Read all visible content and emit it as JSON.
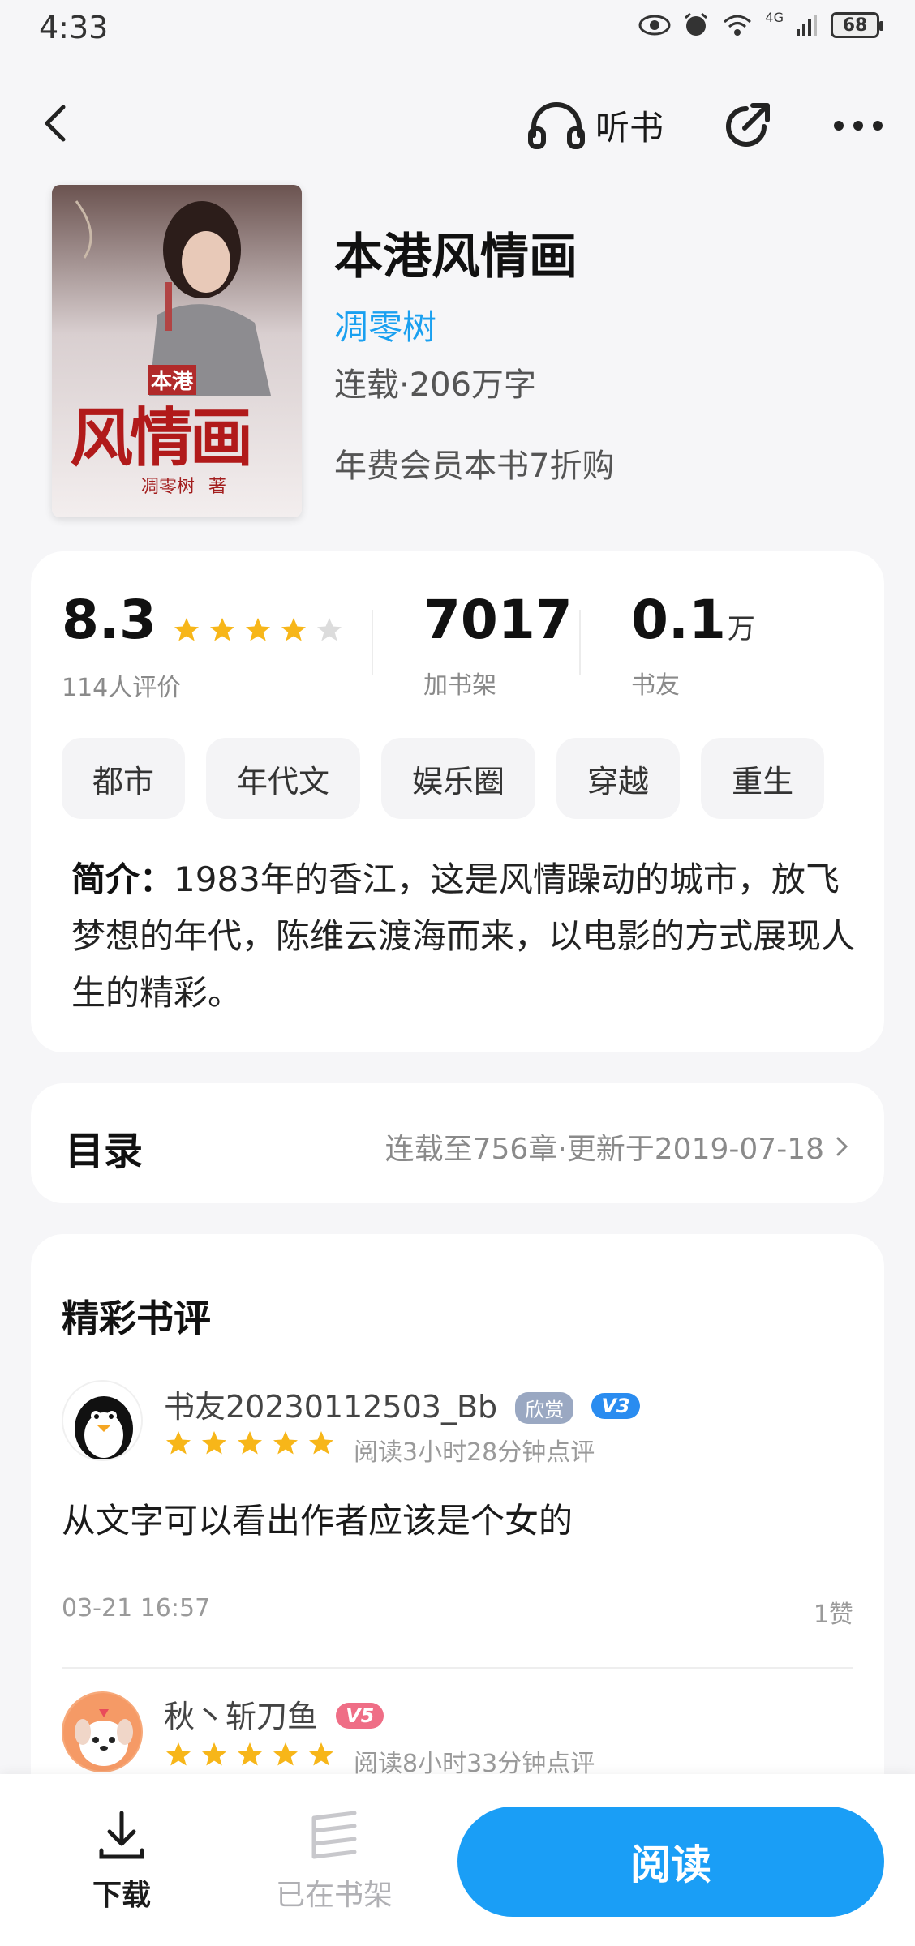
{
  "status_bar": {
    "time": "4:33",
    "network": "4G",
    "battery": "68"
  },
  "nav": {
    "listen_label": "听书"
  },
  "book": {
    "cover_small_text": "本港",
    "cover_big_text": "风情画",
    "cover_author_text": "凋零树",
    "cover_suffix": "著",
    "title": "本港风情画",
    "author": "凋零树",
    "meta": "连载·206万字",
    "offer": "年费会员本书7折购"
  },
  "stats": {
    "rating": "8.3",
    "rating_stars": 4,
    "rating_label": "114人评价",
    "shelf_count": "7017",
    "shelf_label": "加书架",
    "friends_count": "0.1",
    "friends_unit": "万",
    "friends_label": "书友"
  },
  "tags": [
    "都市",
    "年代文",
    "娱乐圈",
    "穿越",
    "重生"
  ],
  "intro": {
    "label": "简介：",
    "text": "1983年的香江，这是风情躁动的城市，放飞梦想的年代，陈维云渡海而来，以电影的方式展现人生的精彩。"
  },
  "toc": {
    "title": "目录",
    "info": "连载至756章·更新于2019-07-18"
  },
  "reviews": {
    "title": "精彩书评",
    "items": [
      {
        "name": "书友20230112503_Bb",
        "badge": "欣赏",
        "level": "V3",
        "stars": 5,
        "read_time": "阅读3小时28分钟点评",
        "content": "从文字可以看出作者应该是个女的",
        "date": "03-21 16:57",
        "likes": "1赞"
      },
      {
        "name": "秋丶斩刀鱼",
        "level": "V5",
        "stars": 5,
        "read_time": "阅读8小时33分钟点评"
      }
    ]
  },
  "bottom_bar": {
    "download_label": "下载",
    "shelf_label": "已在书架",
    "read_label": "阅读"
  },
  "colors": {
    "accent": "#1a9ef6",
    "author": "#1aa0f0",
    "star": "#f7b619",
    "background": "#f6f6f8"
  }
}
